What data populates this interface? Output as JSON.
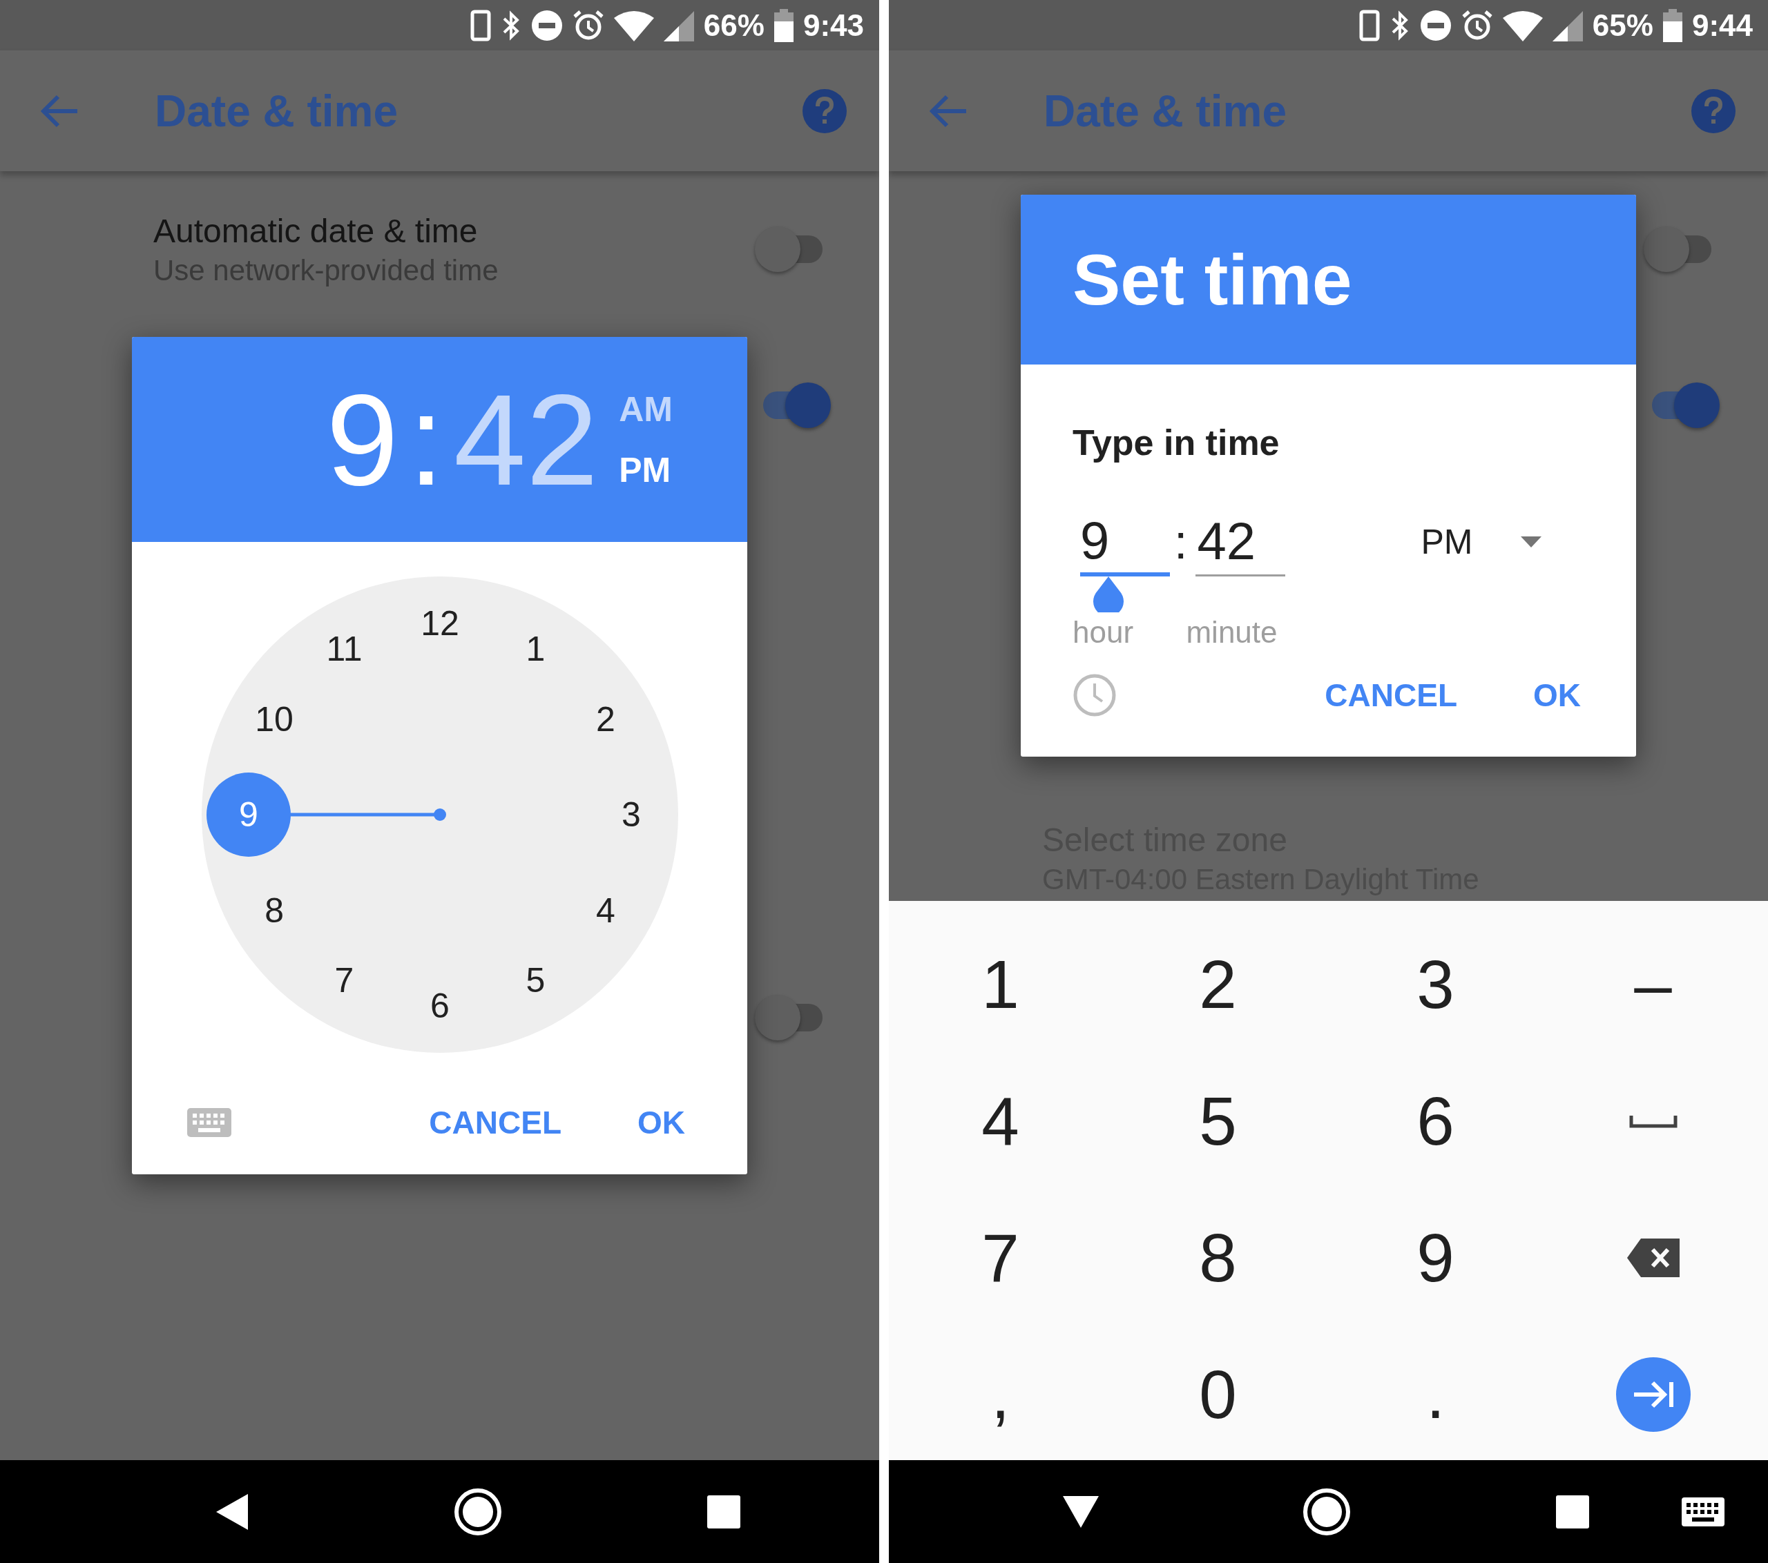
{
  "phones": [
    {
      "status_bar": {
        "battery": "66%",
        "time": "9:43"
      },
      "app_bar": {
        "title": "Date & time"
      },
      "settings": [
        {
          "title": "Automatic date & time",
          "subtitle": "Use network-provided time",
          "disabled": false,
          "on": false
        },
        {
          "on": true
        },
        {
          "on": false
        }
      ],
      "dialog": {
        "kind": "clock",
        "time_display": {
          "hour": {
            "text": "9",
            "selected": true
          },
          "separator": ":",
          "minute": {
            "text": "42",
            "selected": false
          },
          "periods": [
            {
              "label": "AM",
              "selected": false
            },
            {
              "label": "PM",
              "selected": true
            }
          ]
        },
        "numbers": [
          {
            "label": "12",
            "selected": false
          },
          {
            "label": "1",
            "selected": false
          },
          {
            "label": "2",
            "selected": false
          },
          {
            "label": "3",
            "selected": false
          },
          {
            "label": "4",
            "selected": false
          },
          {
            "label": "5",
            "selected": false
          },
          {
            "label": "6",
            "selected": false
          },
          {
            "label": "7",
            "selected": false
          },
          {
            "label": "8",
            "selected": false
          },
          {
            "label": "9",
            "selected": true
          },
          {
            "label": "10",
            "selected": false
          },
          {
            "label": "11",
            "selected": false
          }
        ],
        "buttons": [
          "CANCEL",
          "OK"
        ]
      },
      "nav_buttons": [
        {
          "kind": "back"
        },
        {
          "kind": "home"
        },
        {
          "kind": "recents"
        }
      ]
    },
    {
      "status_bar": {
        "battery": "65%",
        "time": "9:44"
      },
      "app_bar": {
        "title": "Date & time"
      },
      "settings": [
        {
          "on": false
        },
        {
          "on": true
        },
        {
          "title": "Select time zone",
          "subtitle": "GMT-04:00 Eastern Daylight Time",
          "disabled": true
        }
      ],
      "dialog": {
        "kind": "text_input",
        "title": "Set time",
        "prompt": "Type in time",
        "fields": [
          {
            "value": "9",
            "label": "hour",
            "focused": true
          },
          {
            "value": "42",
            "label": "minute",
            "focused": false
          }
        ],
        "separator": ":",
        "dropdown": {
          "value": "PM"
        },
        "buttons": [
          "CANCEL",
          "OK"
        ]
      },
      "keyboard": {
        "keys": [
          {
            "kind": "char",
            "label": "1"
          },
          {
            "kind": "char",
            "label": "2"
          },
          {
            "kind": "char",
            "label": "3"
          },
          {
            "kind": "char",
            "label": "–"
          },
          {
            "kind": "char",
            "label": "4"
          },
          {
            "kind": "char",
            "label": "5"
          },
          {
            "kind": "char",
            "label": "6"
          },
          {
            "kind": "space"
          },
          {
            "kind": "char",
            "label": "7"
          },
          {
            "kind": "char",
            "label": "8"
          },
          {
            "kind": "char",
            "label": "9"
          },
          {
            "kind": "backspace"
          },
          {
            "kind": "char",
            "label": ","
          },
          {
            "kind": "char",
            "label": "0"
          },
          {
            "kind": "char",
            "label": "."
          },
          {
            "kind": "next"
          }
        ]
      },
      "nav_buttons": [
        {
          "kind": "hide"
        },
        {
          "kind": "home"
        },
        {
          "kind": "recents"
        },
        {
          "kind": "ime"
        }
      ]
    }
  ]
}
